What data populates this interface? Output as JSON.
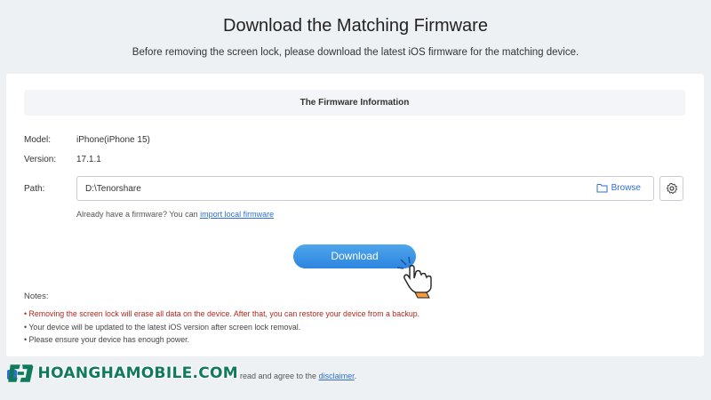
{
  "page": {
    "title": "Download the Matching Firmware",
    "subtitle": "Before removing the screen lock, please download the latest iOS firmware for the matching device."
  },
  "firmware_info": {
    "header": "The Firmware Information",
    "model_label": "Model:",
    "model_value": "iPhone(iPhone 15)",
    "version_label": "Version:",
    "version_value": "17.1.1",
    "path_label": "Path:",
    "path_value": "D:\\Tenorshare",
    "browse_label": "Browse",
    "already_text": "Already have a firmware? You can ",
    "import_link": "import local firmware"
  },
  "actions": {
    "download_label": "Download"
  },
  "notes": {
    "title": "Notes:",
    "items": [
      "Removing the screen lock will erase all data on the device. After that, you can restore your device from a backup.",
      "Your device will be updated to the latest iOS version after screen lock removal.",
      "Please ensure your device has enough power."
    ]
  },
  "footer": {
    "text": "read and agree to the ",
    "link": "disclaimer",
    "period": "."
  },
  "watermark": {
    "text": "HOANGHAMOBILE.COM"
  },
  "colors": {
    "accent": "#2f6fd6",
    "warning": "#b3261e",
    "button": "#3a96e8",
    "watermark": "#0f7a5c"
  },
  "icons": [
    "folder-icon",
    "gear-icon",
    "pointing-hand-icon"
  ]
}
